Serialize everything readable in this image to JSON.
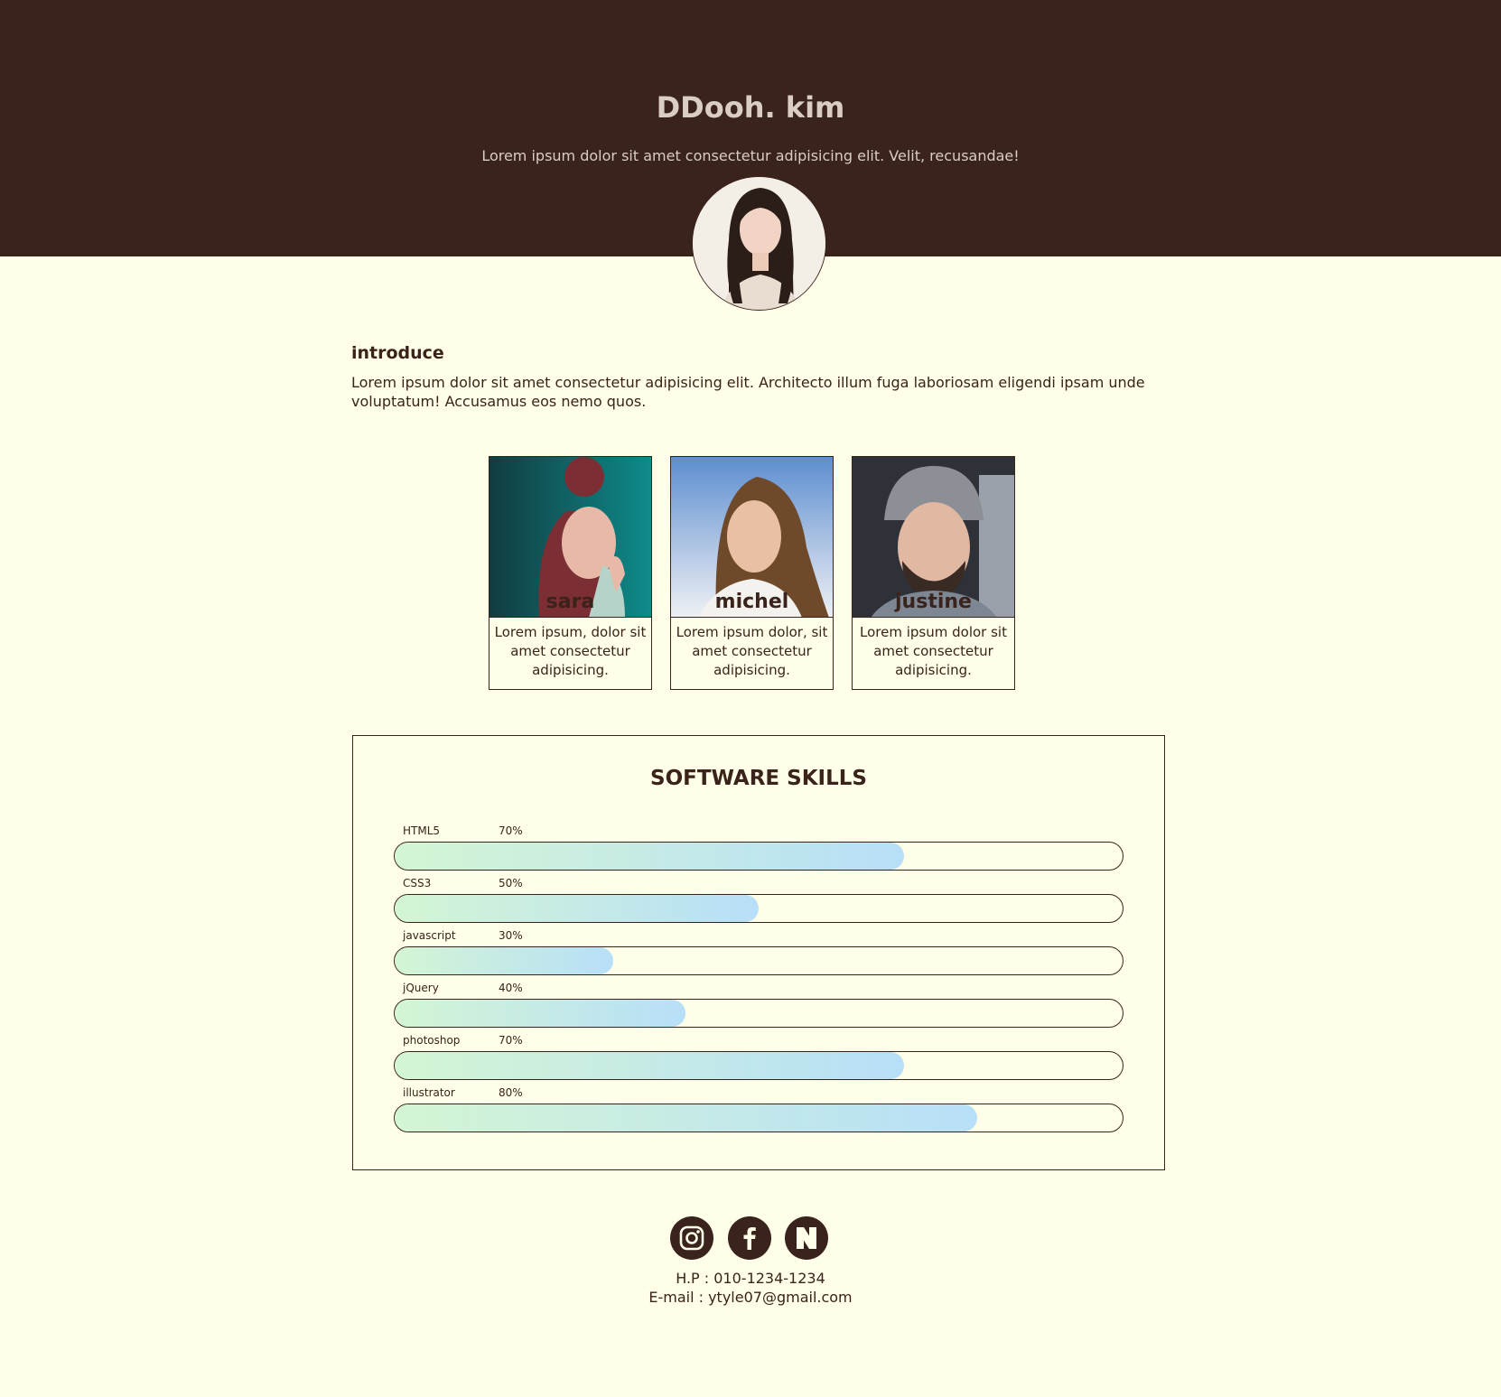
{
  "header": {
    "title": "DDooh. kim",
    "subtitle": "Lorem ipsum dolor sit amet consectetur adipisicing elit. Velit, recusandae!"
  },
  "introduce": {
    "heading": "introduce",
    "text": "Lorem ipsum dolor sit amet consectetur adipisicing elit. Architecto illum fuga laboriosam eligendi ipsam unde voluptatum! Accusamus eos nemo quos."
  },
  "cards": [
    {
      "name": "sara",
      "desc": "Lorem ipsum, dolor sit amet consectetur adipisicing."
    },
    {
      "name": "michel",
      "desc": "Lorem ipsum dolor, sit amet consectetur adipisicing."
    },
    {
      "name": "justine",
      "desc": "Lorem ipsum dolor sit amet consectetur adipisicing."
    }
  ],
  "skills": {
    "title": "SOFTWARE SKILLS",
    "items": [
      {
        "name": "HTML5",
        "percent": "70%",
        "value": 70
      },
      {
        "name": "CSS3",
        "percent": "50%",
        "value": 50
      },
      {
        "name": "javascript",
        "percent": "30%",
        "value": 30
      },
      {
        "name": "jQuery",
        "percent": "40%",
        "value": 40
      },
      {
        "name": "photoshop",
        "percent": "70%",
        "value": 70
      },
      {
        "name": "illustrator",
        "percent": "80%",
        "value": 80
      }
    ]
  },
  "social": {
    "icons": [
      "instagram-icon",
      "facebook-icon",
      "naver-icon"
    ]
  },
  "contact": {
    "phone": "H.P : 010-1234-1234",
    "email": "E-mail : ytyle07@gmail.com"
  },
  "colors": {
    "header_bg": "#39231c",
    "page_bg": "#fffee8",
    "text": "#3a231b",
    "bar_start": "#d3f6d4",
    "bar_end": "#b8dff8"
  }
}
